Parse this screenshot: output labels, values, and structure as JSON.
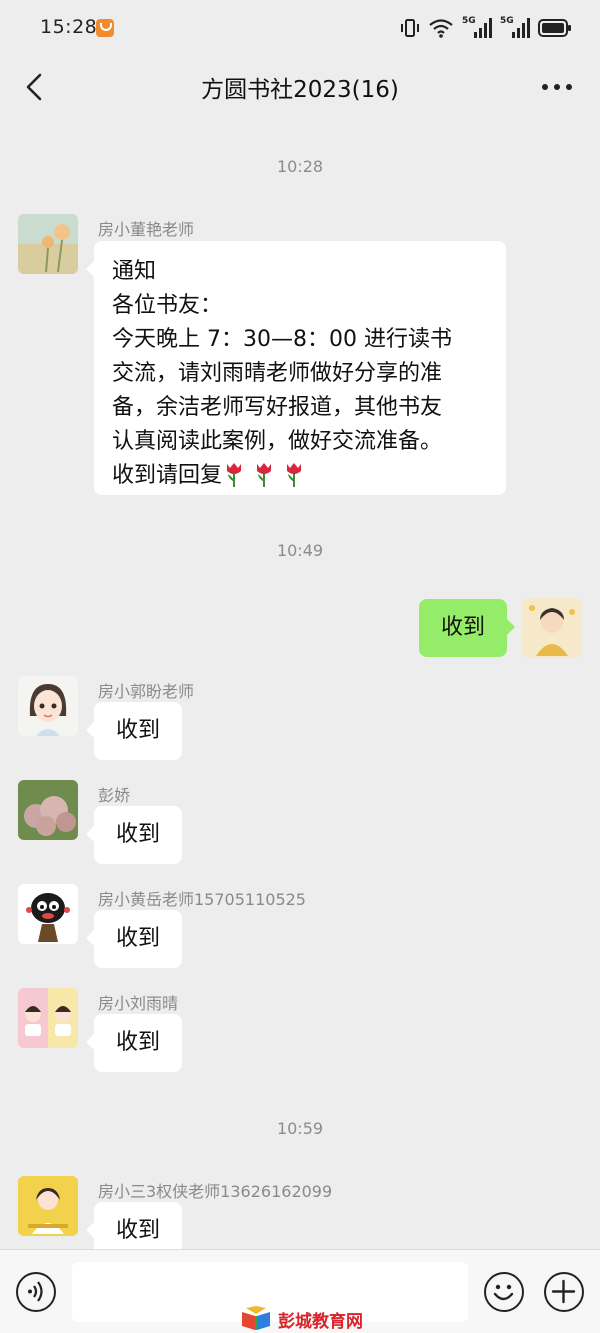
{
  "status_bar": {
    "time": "15:28",
    "signal_labels": [
      "5G",
      "5G"
    ]
  },
  "header": {
    "title": "方圆书社2023(16)",
    "back_icon": "chevron-left-icon",
    "more_icon": "more-dots-icon"
  },
  "timestamps": [
    "10:28",
    "10:49",
    "10:59"
  ],
  "messages": [
    {
      "sender": "房小董艳老师",
      "lines": [
        "通知",
        "各位书友：",
        "今天晚上 7：30—8：00 进行读书",
        "交流，请刘雨晴老师做好分享的准",
        "备，余洁老师写好报道，其他书友",
        "认真阅读此案例，做好交流准备。",
        "收到请回复"
      ]
    },
    {
      "mine": true,
      "text": "收到"
    },
    {
      "sender": "房小郭盼老师",
      "text": "收到"
    },
    {
      "sender": "彭娇",
      "text": "收到"
    },
    {
      "sender": "房小黄岳老师15705110525",
      "text": "收到"
    },
    {
      "sender": "房小刘雨晴",
      "text": "收到"
    },
    {
      "sender": "房小三3权侠老师13626162099",
      "text": "收到"
    }
  ],
  "input_bar": {
    "voice_icon": "voice-icon",
    "emoji_icon": "emoji-icon",
    "plus_icon": "plus-icon",
    "input_value": ""
  },
  "watermark": {
    "text": "彭城教育网"
  },
  "colors": {
    "background": "#ededed",
    "bubble_mine": "#95ec69",
    "bubble_other": "#ffffff",
    "watermark": "#d8232a"
  }
}
